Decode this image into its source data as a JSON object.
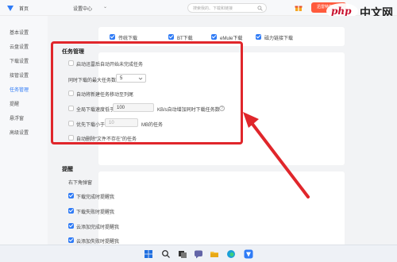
{
  "app": {
    "title": "首页"
  },
  "window": {
    "title": "设置中心"
  },
  "search": {
    "placeholder": "搜索我的、下载和链接"
  },
  "vip_button": {
    "label": "迅雷特权会员"
  },
  "watermark": {
    "text_php": "php",
    "text_cn": "中文网"
  },
  "sidebar": {
    "items": [
      {
        "label": "基本设置",
        "active": false
      },
      {
        "label": "云盘设置",
        "active": false
      },
      {
        "label": "下载设置",
        "active": false
      },
      {
        "label": "接管设置",
        "active": false
      },
      {
        "label": "任务管理",
        "active": true
      },
      {
        "label": "提醒",
        "active": false
      },
      {
        "label": "悬浮窗",
        "active": false
      },
      {
        "label": "高级设置",
        "active": false
      }
    ]
  },
  "takeover": {
    "options": [
      {
        "label": "传统下载",
        "checked": true
      },
      {
        "label": "BT下载",
        "checked": true
      },
      {
        "label": "eMule下载",
        "checked": true
      },
      {
        "label": "磁力链接下载",
        "checked": true
      }
    ]
  },
  "task_management": {
    "title": "任务管理",
    "auto_start_label": "启动迅雷后自动开始未完成任务",
    "max_tasks_label": "同时下载的最大任务数",
    "max_tasks_value": "5",
    "move_new_tasks_label": "自动将新建任务移动至列尾",
    "speed_label": "全局下载速度低于",
    "speed_value": "100",
    "speed_suffix": "KB/s自动增加同时下载任务数",
    "size_label": "优先下载小于",
    "size_value": "10",
    "size_suffix": "MB的任务",
    "delete_missing_label": "自动删除“文件不存在”的任务"
  },
  "reminder": {
    "title": "提醒",
    "subtitle": "右下角弹窗",
    "options": [
      {
        "label": "下载完成时提醒我",
        "checked": true
      },
      {
        "label": "下载失败时提醒我",
        "checked": true
      },
      {
        "label": "云添加完成时提醒我",
        "checked": true
      },
      {
        "label": "云添加失败时提醒我",
        "checked": true
      }
    ]
  },
  "colors": {
    "accent": "#2f7bf6",
    "annotation": "#e0262b",
    "vip": "#ff5a3c"
  },
  "taskbar": {
    "icons": [
      "windows-start-icon",
      "search-icon",
      "task-view-icon",
      "chat-icon",
      "file-explorer-icon",
      "store-icon",
      "edge-icon",
      "thunder-icon"
    ]
  }
}
